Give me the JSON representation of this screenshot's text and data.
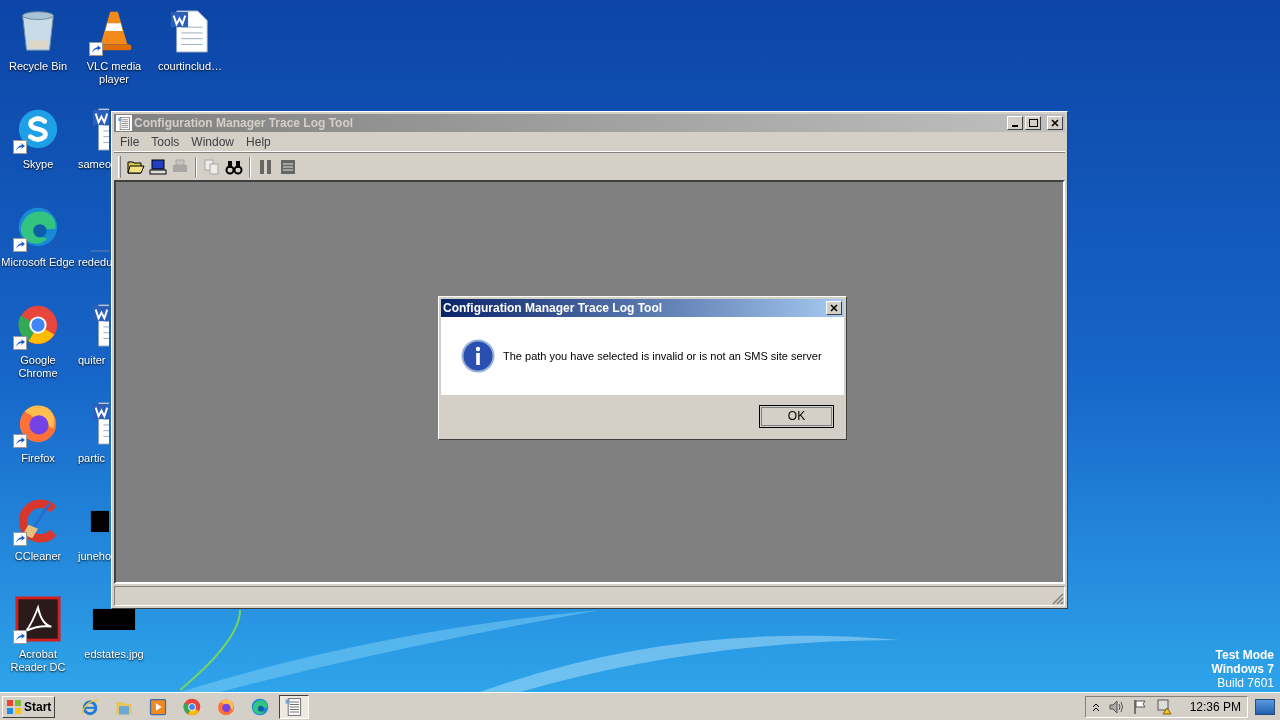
{
  "desktop": {
    "columns": [
      [
        {
          "label": "Recycle Bin",
          "kind": "recycle",
          "shortcut": false,
          "covered": false
        },
        {
          "label": "Skype",
          "kind": "skype",
          "shortcut": true,
          "covered": false
        },
        {
          "label": "Microsoft Edge",
          "kind": "edge",
          "shortcut": true,
          "covered": false
        },
        {
          "label": "Google Chrome",
          "kind": "chrome",
          "shortcut": true,
          "covered": false
        },
        {
          "label": "Firefox",
          "kind": "firefox",
          "shortcut": true,
          "covered": false
        },
        {
          "label": "CCleaner",
          "kind": "ccleaner",
          "shortcut": true,
          "covered": false
        },
        {
          "label": "Acrobat Reader DC",
          "kind": "acrobat",
          "shortcut": true,
          "covered": false
        }
      ],
      [
        {
          "label": "VLC media player",
          "kind": "vlc",
          "shortcut": true,
          "covered": false
        },
        {
          "label": "sameo",
          "kind": "doc",
          "shortcut": false,
          "covered": true
        },
        {
          "label": "rededu",
          "kind": "blank",
          "shortcut": false,
          "covered": true
        },
        {
          "label": "quiter",
          "kind": "doc",
          "shortcut": false,
          "covered": true
        },
        {
          "label": "partic",
          "kind": "doc",
          "shortcut": false,
          "covered": true
        },
        {
          "label": "juneho",
          "kind": "thumb",
          "shortcut": false,
          "covered": true
        },
        {
          "label": "edstates.jpg",
          "kind": "thumb",
          "shortcut": false,
          "covered": false
        }
      ],
      [
        {
          "label": "courtinclud…",
          "kind": "doc",
          "shortcut": false,
          "covered": false
        }
      ]
    ],
    "os_notice": [
      {
        "text": "Test Mode",
        "bold": true
      },
      {
        "text": "Windows 7",
        "bold": true
      },
      {
        "text": "Build 7601",
        "bold": false
      }
    ]
  },
  "window": {
    "title": "Configuration Manager Trace Log Tool",
    "active": false,
    "menu": [
      "File",
      "Tools",
      "Window",
      "Help"
    ],
    "toolbar": [
      {
        "kind": "open",
        "disabled": false
      },
      {
        "kind": "computer",
        "disabled": false
      },
      {
        "kind": "print",
        "disabled": true
      },
      {
        "kind": "separator"
      },
      {
        "kind": "copy",
        "disabled": true
      },
      {
        "kind": "find",
        "disabled": false
      },
      {
        "kind": "separator"
      },
      {
        "kind": "pause",
        "disabled": false
      },
      {
        "kind": "list",
        "disabled": false
      }
    ]
  },
  "dialog": {
    "title": "Configuration Manager Trace Log Tool",
    "active": true,
    "message": "The path you have selected is invalid or is not an SMS site server",
    "buttons": [
      "OK"
    ]
  },
  "taskbar": {
    "start": "Start",
    "apps": [
      {
        "kind": "ie",
        "selected": false
      },
      {
        "kind": "explorer",
        "selected": false
      },
      {
        "kind": "media",
        "selected": false
      },
      {
        "kind": "chrome",
        "selected": false
      },
      {
        "kind": "firefox",
        "selected": false
      },
      {
        "kind": "edge",
        "selected": false
      },
      {
        "kind": "tracelog",
        "selected": true
      }
    ],
    "clock": "12:36 PM"
  }
}
